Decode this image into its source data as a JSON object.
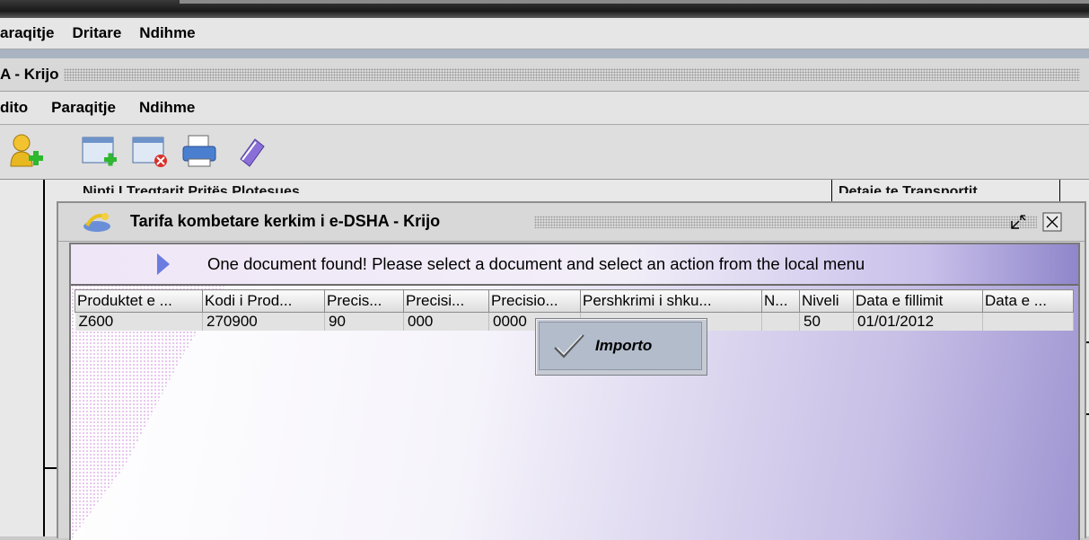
{
  "app": {
    "menu": [
      "araqitje",
      "Dritare",
      "Ndihme"
    ],
    "window_title": "A - Krijo",
    "menu2": [
      "dito",
      "Paraqitje",
      "Ndihme"
    ],
    "toolbar_icons": [
      "user-add-icon",
      "window-add-icon",
      "window-remove-icon",
      "print-icon",
      "book-icon"
    ]
  },
  "background": {
    "left_header": "Nipti I Tregtarit Pritës Plotesues",
    "right_header": "Detaje te Transportit"
  },
  "dialog": {
    "title": "Tarifa kombetare kerkim i e-DSHA - Krijo",
    "message": "One document found! Please select a document and select an action from the local menu",
    "columns": [
      "Produktet e ...",
      "Kodi i Prod...",
      "Precis...",
      "Precisi...",
      "Precisio...",
      "Pershkrimi i shku...",
      "N...",
      "Niveli",
      "Data e fillimit",
      "Data e ..."
    ],
    "rows": [
      [
        "Z600",
        "270900",
        "90",
        "000",
        "0000",
        "",
        "",
        "50",
        "01/01/2012",
        ""
      ]
    ]
  },
  "context_menu": {
    "items": [
      {
        "label": "Importo",
        "icon": "checkmark-icon"
      }
    ]
  },
  "colors": {
    "accent_triangle": "#6b7be0",
    "gradient_end": "#9e95d2"
  }
}
